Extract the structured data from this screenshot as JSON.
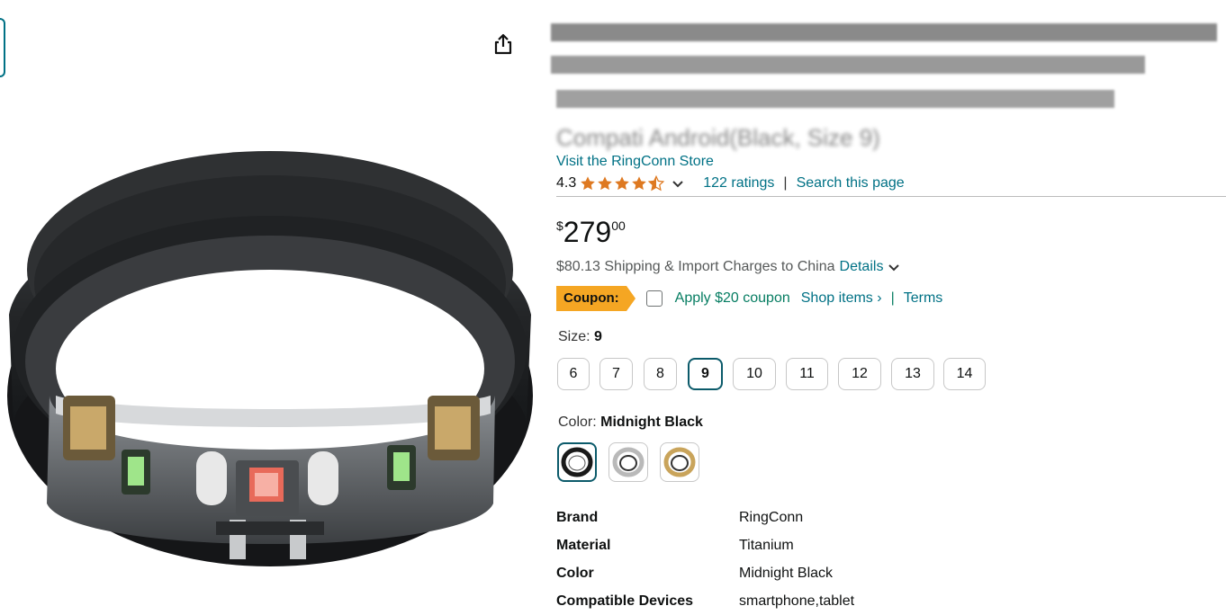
{
  "product": {
    "store_link": "Visit the RingConn Store",
    "title_visible_fragment": "Compati                    Android(Black, Size 9)",
    "rating": "4.3",
    "ratings_count": "122 ratings",
    "search_link": "Search this page",
    "star_fill": [
      1,
      1,
      1,
      1,
      0.5
    ]
  },
  "price": {
    "symbol": "$",
    "whole": "279",
    "fraction": "00"
  },
  "shipping": {
    "text": "$80.13 Shipping & Import Charges to China",
    "details_link": "Details"
  },
  "coupon": {
    "badge": "Coupon:",
    "apply": "Apply $20 coupon",
    "shop_items": "Shop items ›",
    "separator": "|",
    "terms": "Terms"
  },
  "size": {
    "label": "Size:",
    "selected": "9",
    "options": [
      "6",
      "7",
      "8",
      "9",
      "10",
      "11",
      "12",
      "13",
      "14"
    ]
  },
  "color": {
    "label": "Color:",
    "selected": "Midnight Black",
    "swatches": [
      "midnight-black",
      "silver",
      "gold"
    ],
    "swatch_colors": [
      "#1a1a1a",
      "#b9b9b9",
      "#c9a45b"
    ]
  },
  "specs": [
    {
      "key": "Brand",
      "value": "RingConn"
    },
    {
      "key": "Material",
      "value": "Titanium"
    },
    {
      "key": "Color",
      "value": "Midnight Black"
    },
    {
      "key": "Compatible Devices",
      "value": "smartphone,tablet"
    }
  ],
  "colors": {
    "link": "#007185",
    "coupon_badge": "#f5a623",
    "coupon_green": "#067d62",
    "star": "#de7921"
  }
}
